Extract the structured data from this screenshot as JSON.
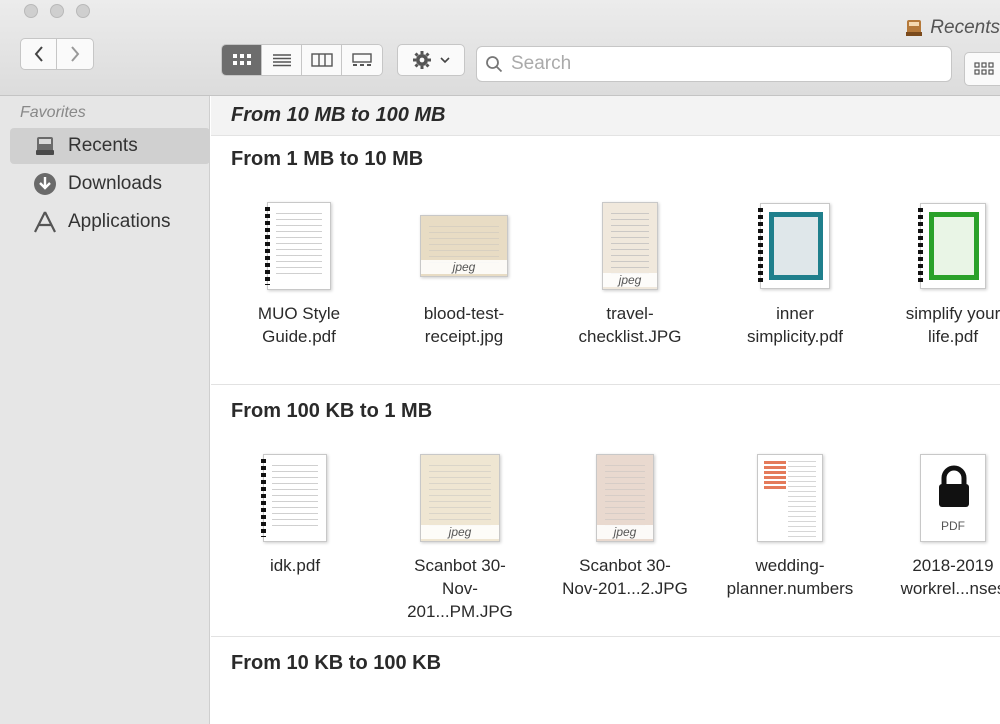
{
  "window": {
    "title": "Recents"
  },
  "toolbar": {
    "search_placeholder": "Search",
    "view_modes": [
      "icon-view",
      "list-view",
      "column-view",
      "gallery-view"
    ]
  },
  "sidebar": {
    "heading": "Favorites",
    "items": [
      {
        "label": "Recents",
        "icon": "recents-icon",
        "selected": true
      },
      {
        "label": "Downloads",
        "icon": "downloads-icon",
        "selected": false
      },
      {
        "label": "Applications",
        "icon": "applications-icon",
        "selected": false
      }
    ]
  },
  "groups": [
    {
      "title": "From 10 MB to 100 MB",
      "files": []
    },
    {
      "title": "From 1 MB to 10 MB",
      "files": [
        {
          "name": "MUO Style\nGuide.pdf",
          "kind": "pdf-doc"
        },
        {
          "name": "blood-test-\nreceipt.jpg",
          "kind": "jpeg",
          "tag": "jpeg"
        },
        {
          "name": "travel-\nchecklist.JPG",
          "kind": "jpeg-tall",
          "tag": "jpeg"
        },
        {
          "name": "inner\nsimplicity.pdf",
          "kind": "pdf-teal"
        },
        {
          "name": "simplify your\nlife.pdf",
          "kind": "pdf-green"
        }
      ]
    },
    {
      "title": "From 100 KB to 1 MB",
      "files": [
        {
          "name": "idk.pdf",
          "kind": "pdf-doc"
        },
        {
          "name": "Scanbot 30-\nNov-201...PM.JPG",
          "kind": "jpeg",
          "tag": "jpeg"
        },
        {
          "name": "Scanbot 30-\nNov-201...2.JPG",
          "kind": "jpeg-tall",
          "tag": "jpeg"
        },
        {
          "name": "wedding-\nplanner.numbers",
          "kind": "numbers"
        },
        {
          "name": "2018-2019\nworkrel...nses",
          "kind": "pdf-locked",
          "tag": "PDF"
        }
      ]
    },
    {
      "title": "From 10 KB to 100 KB",
      "files": []
    }
  ],
  "colors": {
    "teal": "#1f7f8c",
    "green": "#2aa12a",
    "selected_bg": "#d0d0d0"
  }
}
